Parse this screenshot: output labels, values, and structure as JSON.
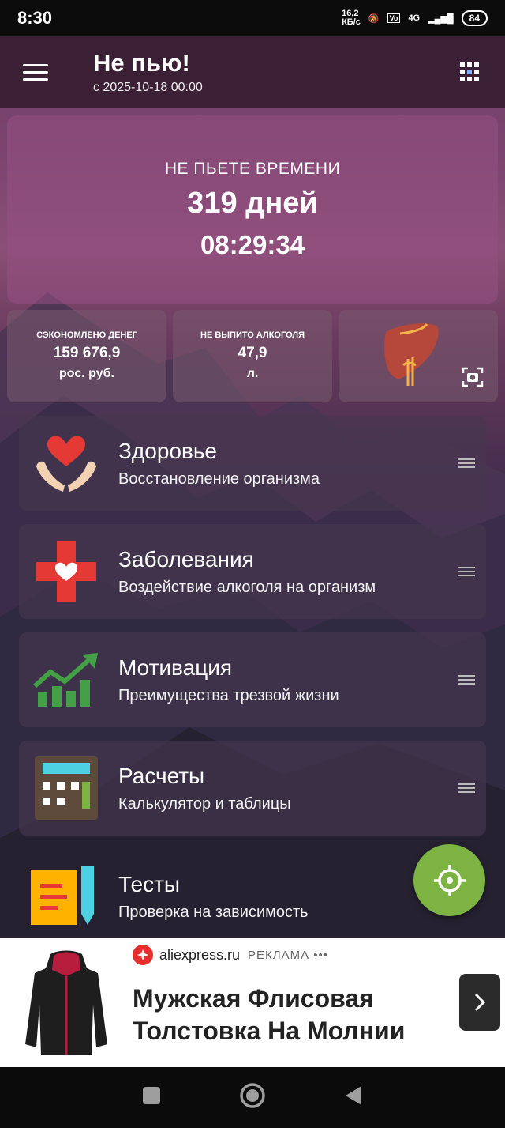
{
  "status_bar": {
    "time": "8:30",
    "net_speed": "16,2\nКБ/с",
    "network": "4G",
    "battery": "84"
  },
  "app_bar": {
    "title": "Не пью!",
    "subtitle": "с 2025-10-18 00:00"
  },
  "timer": {
    "label": "НЕ ПЬЕТЕ ВРЕМЕНИ",
    "days": "319 дней",
    "clock": "08:29:34"
  },
  "stats": [
    {
      "label": "СЭКОНОМЛЕНО ДЕНЕГ",
      "value": "159 676,9",
      "unit": "рос. руб."
    },
    {
      "label": "НЕ ВЫПИТО АЛКОГОЛЯ",
      "value": "47,9",
      "unit": "л."
    }
  ],
  "menu": [
    {
      "title": "Здоровье",
      "desc": "Восстановление организма",
      "icon": "heart-hands-icon"
    },
    {
      "title": "Заболевания",
      "desc": "Воздействие алкоголя на организм",
      "icon": "medical-cross-icon"
    },
    {
      "title": "Мотивация",
      "desc": "Преимущества трезвой жизни",
      "icon": "growth-chart-icon"
    },
    {
      "title": "Расчеты",
      "desc": "Калькулятор и таблицы",
      "icon": "calculator-icon"
    },
    {
      "title": "Тесты",
      "desc": "Проверка на зависимость",
      "icon": "test-notes-icon"
    }
  ],
  "ad": {
    "source": "aliexpress.ru",
    "tag": "РЕКЛАМА •••",
    "headline": "Мужская Флисовая Толстовка На Молнии"
  },
  "colors": {
    "app_bar": "#3b1f35",
    "fab": "#7cb342",
    "ad_brand": "#e62e2d"
  }
}
